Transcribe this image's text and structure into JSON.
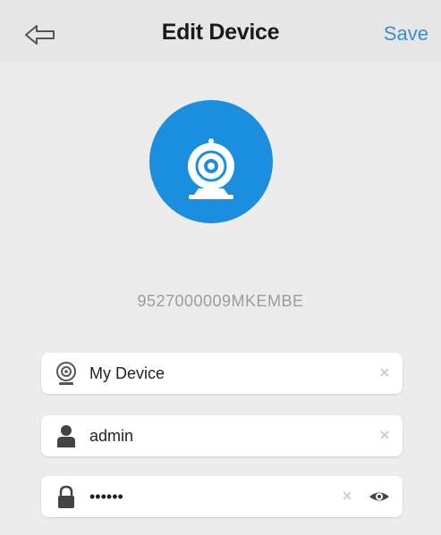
{
  "header": {
    "back_icon": "back-arrow-icon",
    "title": "Edit Device",
    "save_label": "Save"
  },
  "device": {
    "avatar_icon": "webcam-icon",
    "id": "9527000009MKEMBE"
  },
  "form": {
    "name": {
      "value": "My Device",
      "icon": "camera-icon",
      "clear_icon": "clear-icon"
    },
    "username": {
      "value": "admin",
      "icon": "user-icon",
      "clear_icon": "clear-icon"
    },
    "password": {
      "value": "••••••",
      "icon": "lock-icon",
      "clear_icon": "clear-icon",
      "toggle_icon": "eye-icon"
    }
  },
  "colors": {
    "accent": "#3a8fd0",
    "avatar_bg": "#1b8fde",
    "header_bg": "#e6e6e6",
    "page_bg": "#ececec"
  }
}
